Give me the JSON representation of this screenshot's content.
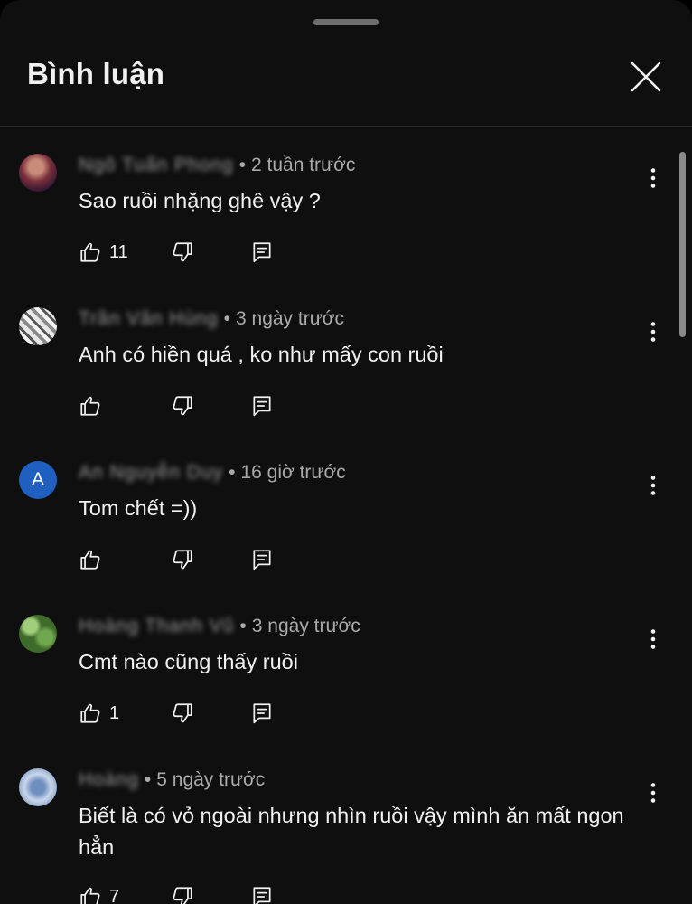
{
  "sheet": {
    "title": "Bình luận"
  },
  "comments": [
    {
      "author": "Ngô Tuấn Phong",
      "time": "2 tuần trước",
      "text": "Sao ruồi nhặng ghê vậy ?",
      "likes": "11",
      "avatar_letter": ""
    },
    {
      "author": "Trần Văn Hùng",
      "time": "3 ngày trước",
      "text": "Anh có hiền quá , ko như mấy con ruồi",
      "likes": "",
      "avatar_letter": ""
    },
    {
      "author": "An Nguyễn Duy",
      "time": "16 giờ trước",
      "text": "Tom chết =))",
      "likes": "",
      "avatar_letter": "A"
    },
    {
      "author": "Hoàng Thanh Vũ",
      "time": "3 ngày trước",
      "text": "Cmt nào cũng thấy ruồi",
      "likes": "1",
      "avatar_letter": ""
    },
    {
      "author": "Hoàng",
      "time": "5 ngày trước",
      "text": "Biết là có vỏ ngoài nhưng nhìn ruồi vậy mình ăn mất ngon hẳn",
      "likes": "7",
      "avatar_letter": ""
    }
  ],
  "colors": {
    "background": "#0f0f0f",
    "text_primary": "#f1f1f1",
    "text_secondary": "#aaaaaa",
    "avatar_letter_bg": "#1f5fbf"
  },
  "icons": {
    "close": "close-icon",
    "like": "thumbs-up-icon",
    "dislike": "thumbs-down-icon",
    "reply": "reply-icon",
    "more": "more-vertical-icon"
  }
}
